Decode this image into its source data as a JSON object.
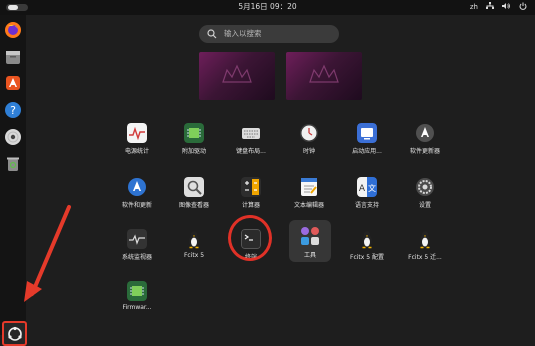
{
  "topbar": {
    "datetime": "5月16日 09：20",
    "input_method": "zh"
  },
  "search": {
    "placeholder": "Q 输入以搜索",
    "placeholder_text": "输入以搜索"
  },
  "dock": {
    "items": [
      {
        "name": "firefox",
        "icon": "firefox-icon"
      },
      {
        "name": "files",
        "icon": "folder-icon"
      },
      {
        "name": "software",
        "icon": "store-icon"
      },
      {
        "name": "help",
        "icon": "help-icon"
      },
      {
        "name": "disc",
        "icon": "disc-icon"
      },
      {
        "name": "trash",
        "icon": "trash-icon"
      }
    ],
    "show_apps": "grid-icon"
  },
  "apps": [
    {
      "label": "电源统计"
    },
    {
      "label": "附加驱动"
    },
    {
      "label": "键盘布局..."
    },
    {
      "label": "时钟"
    },
    {
      "label": "启动应用..."
    },
    {
      "label": "软件更新器"
    },
    {
      "label": "软件和更新"
    },
    {
      "label": "图像查看器"
    },
    {
      "label": "计算器"
    },
    {
      "label": "文本编辑器"
    },
    {
      "label": "语言支持"
    },
    {
      "label": "设置"
    },
    {
      "label": "系统监视器"
    },
    {
      "label": "Fcitx 5"
    },
    {
      "label": "终端"
    },
    {
      "label": "工具"
    },
    {
      "label": "Fcitx 5 配置"
    },
    {
      "label": "Fcitx 5 迁..."
    },
    {
      "label": "Firmwar..."
    }
  ],
  "colors": {
    "accent": "#e95420",
    "annotation": "#e53a2a"
  }
}
